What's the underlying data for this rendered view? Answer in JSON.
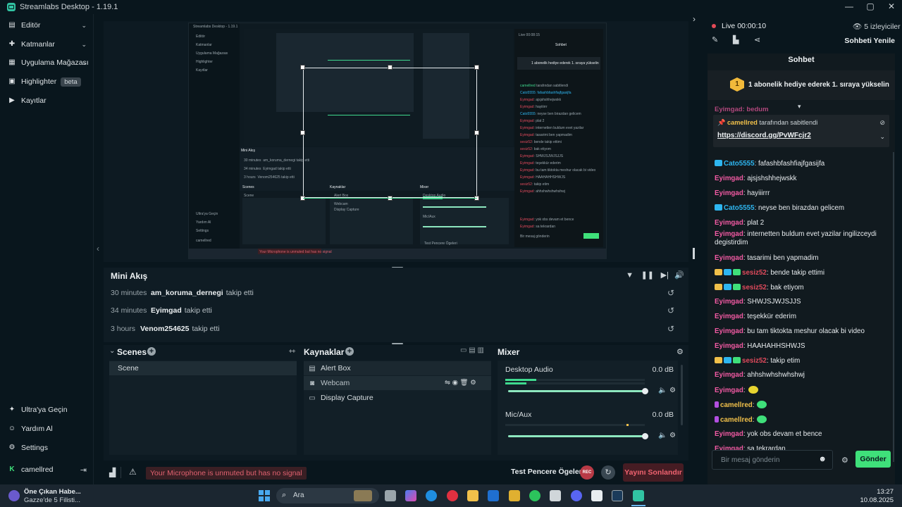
{
  "window": {
    "title": "Streamlabs Desktop - 1.19.1"
  },
  "nav": {
    "items": [
      {
        "label": "Editör",
        "icon": "editor-icon",
        "chevron": true
      },
      {
        "label": "Katmanlar",
        "icon": "layers-icon",
        "chevron": true
      },
      {
        "label": "Uygulama Mağazası",
        "icon": "store-icon",
        "chevron": true
      },
      {
        "label": "Highlighter",
        "icon": "highlighter-icon",
        "badge": "beta"
      },
      {
        "label": "Kayıtlar",
        "icon": "recordings-icon"
      }
    ],
    "bottom": [
      {
        "label": "Ultra'ya Geçin",
        "icon": "ultra-icon"
      },
      {
        "label": "Yardım Al",
        "icon": "help-icon"
      },
      {
        "label": "Settings",
        "icon": "settings-icon"
      },
      {
        "label": "camellred",
        "icon": "kick-icon"
      }
    ]
  },
  "mini_feed": {
    "title": "Mini Akış",
    "rows": [
      {
        "time": "30 minutes",
        "user": "am_koruma_dernegi",
        "action": "takip etti"
      },
      {
        "time": "34 minutes",
        "user": "Eyimgad",
        "action": "takip etti"
      },
      {
        "time": "3 hours",
        "user": "Venom254625",
        "action": "takip etti"
      }
    ]
  },
  "scenes": {
    "title": "Scenes",
    "items": [
      "Scene"
    ]
  },
  "sources": {
    "title": "Kaynaklar",
    "items": [
      {
        "label": "Alert Box",
        "icon": "alert-box-icon"
      },
      {
        "label": "Webcam",
        "icon": "webcam-icon"
      },
      {
        "label": "Display Capture",
        "icon": "monitor-icon"
      }
    ]
  },
  "mixer": {
    "title": "Mixer",
    "channels": [
      {
        "name": "Desktop Audio",
        "level": "0.0 dB",
        "meter": 0.22,
        "volume": 1.0
      },
      {
        "name": "Mic/Aux",
        "level": "0.0 dB",
        "meter": 0.0,
        "volume": 1.0
      }
    ]
  },
  "bottom_bar": {
    "mic_warning": "Your Microphone is unmuted but has no signal",
    "test_label": "Test Pencere Ögeleri",
    "rec_label": "REC",
    "end_stream": "Yayını Sonlandır"
  },
  "chat": {
    "live_label": "Live",
    "live_time": "00:00:10",
    "viewers": "5 izleyiciler",
    "refresh": "Sohbeti Yenile",
    "title": "Sohbet",
    "gift_count": "1",
    "gift_text": "1 abonelik hediye ederek 1. sıraya yükselin",
    "pinned_by": "camellred",
    "pinned_suffix": "tarafından sabitlendi",
    "pinned_link": "https://discord.gg/PvWFcjr2",
    "messages": [
      {
        "user": "Cato5555",
        "text": ": fafashbfashfiajfgasijfa",
        "color": "blue"
      },
      {
        "user": "Eyimgad",
        "text": ": ajsjshshhejwskk",
        "color": "pink"
      },
      {
        "user": "Eyimgad",
        "text": ": hayiiirrr",
        "color": "pink"
      },
      {
        "user": "Cato5555",
        "text": ": neyse ben birazdan gelicem",
        "color": "blue"
      },
      {
        "user": "Eyimgad",
        "text": ": plat 2",
        "color": "pink"
      },
      {
        "user": "Eyimgad",
        "text": ": internetten buldum evet yazilar ingilizceydi degistirdim",
        "color": "pink"
      },
      {
        "user": "Eyimgad",
        "text": ": tasarimi ben yapmadim",
        "color": "pink"
      },
      {
        "user": "sesiz52",
        "text": ": bende takip ettimi",
        "color": "red"
      },
      {
        "user": "sesiz52",
        "text": ": bak etiyom",
        "color": "red"
      },
      {
        "user": "Eyimgad",
        "text": ": SHWJSJWJSJJS",
        "color": "pink"
      },
      {
        "user": "Eyimgad",
        "text": ": teşekkür ederim",
        "color": "pink"
      },
      {
        "user": "Eyimgad",
        "text": ": bu tam tiktokta meshur olacak bi video",
        "color": "pink"
      },
      {
        "user": "Eyimgad",
        "text": ": HAAHAHHSHWJS",
        "color": "pink"
      },
      {
        "user": "sesiz52",
        "text": ": takip etim",
        "color": "red"
      },
      {
        "user": "Eyimgad",
        "text": ": ahhshwhshwhshwj",
        "color": "pink"
      },
      {
        "user": "Eyimgad",
        "text": ":",
        "color": "pink"
      },
      {
        "user": "camellred",
        "text": ":",
        "color": "gold"
      },
      {
        "user": "camellred",
        "text": ":",
        "color": "gold"
      },
      {
        "user": "Eyimgad",
        "text": ": yok obs devam et bence",
        "color": "pink"
      },
      {
        "user": "Eyimgad",
        "text": ": sa tekrardan",
        "color": "pink"
      }
    ],
    "input_placeholder": "Bir mesaj gönderin",
    "send": "Gönder"
  },
  "taskbar": {
    "news_title": "Öne Çıkan Habe...",
    "news_sub": "Gazze'de 5 Filisti...",
    "search": "Ara",
    "time": "13:27",
    "date": "10.08.2025"
  },
  "colors": {
    "accent": "#31c3a2",
    "green": "#3fe07a",
    "danger": "#e04a5c",
    "pink": "#f25aa3",
    "blue": "#2eb6f0"
  }
}
